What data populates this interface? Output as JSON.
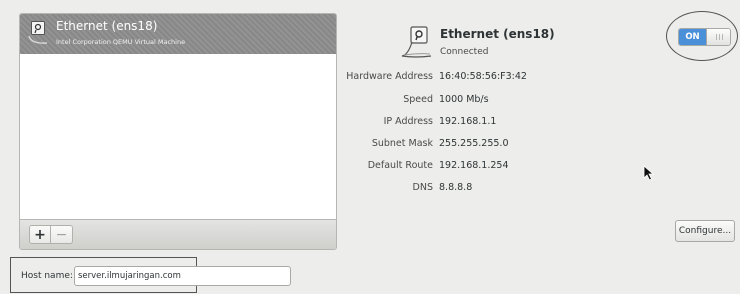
{
  "device_list": {
    "items": [
      {
        "name": "Ethernet (ens18)",
        "description": "Intel Corporation QEMU Virtual Machine"
      }
    ],
    "add_label": "+",
    "remove_label": "−"
  },
  "device_detail": {
    "title": "Ethernet (ens18)",
    "status": "Connected",
    "switch_label": "ON",
    "properties": [
      {
        "label": "Hardware Address",
        "value": "16:40:58:56:F3:42"
      },
      {
        "label": "Speed",
        "value": "1000 Mb/s"
      },
      {
        "label": "IP Address",
        "value": "192.168.1.1"
      },
      {
        "label": "Subnet Mask",
        "value": "255.255.255.0"
      },
      {
        "label": "Default Route",
        "value": "192.168.1.254"
      },
      {
        "label": "DNS",
        "value": "8.8.8.8"
      }
    ],
    "configure_label": "Configure..."
  },
  "host": {
    "label": "Host name:",
    "value": "server.ilmujaringan.com"
  },
  "icons": [
    "ethernet-icon",
    "mouse-pointer-icon"
  ],
  "colors": {
    "selected_row": "#8d8d8d",
    "switch_on": "#4a90d9",
    "annotation": "#555555"
  }
}
